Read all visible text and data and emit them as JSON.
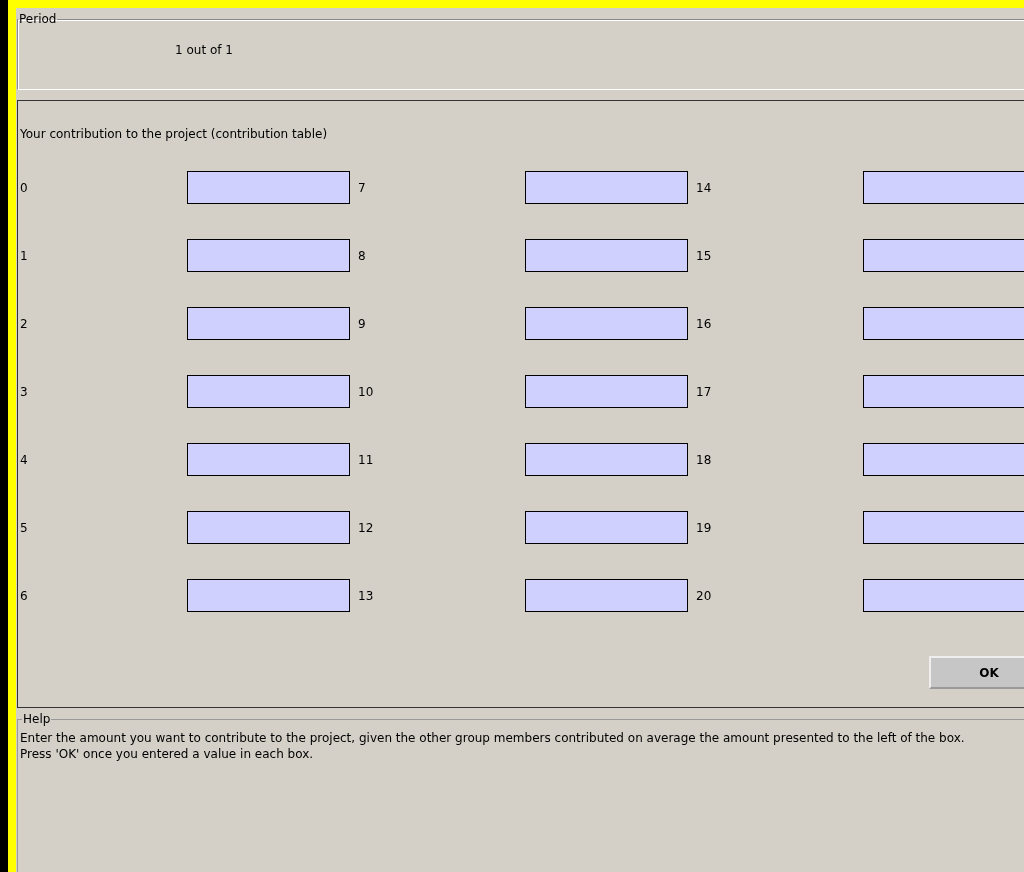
{
  "period": {
    "title": "Period",
    "value": "1 out of 1"
  },
  "contribution": {
    "heading": "Your contribution to the project (contribution table)",
    "rows": [
      {
        "cells": [
          {
            "label": "0"
          },
          {
            "label": "7"
          },
          {
            "label": "14"
          }
        ]
      },
      {
        "cells": [
          {
            "label": "1"
          },
          {
            "label": "8"
          },
          {
            "label": "15"
          }
        ]
      },
      {
        "cells": [
          {
            "label": "2"
          },
          {
            "label": "9"
          },
          {
            "label": "16"
          }
        ]
      },
      {
        "cells": [
          {
            "label": "3"
          },
          {
            "label": "10"
          },
          {
            "label": "17"
          }
        ]
      },
      {
        "cells": [
          {
            "label": "4"
          },
          {
            "label": "11"
          },
          {
            "label": "18"
          }
        ]
      },
      {
        "cells": [
          {
            "label": "5"
          },
          {
            "label": "12"
          },
          {
            "label": "19"
          }
        ]
      },
      {
        "cells": [
          {
            "label": "6"
          },
          {
            "label": "13"
          },
          {
            "label": "20"
          }
        ]
      }
    ],
    "ok_button": "OK"
  },
  "help": {
    "title": "Help",
    "lines": [
      "Enter the amount you want to contribute to the project, given the other group members contributed on average the amount presented to the left of the box.",
      "Press 'OK' once you entered a value in each box."
    ]
  }
}
